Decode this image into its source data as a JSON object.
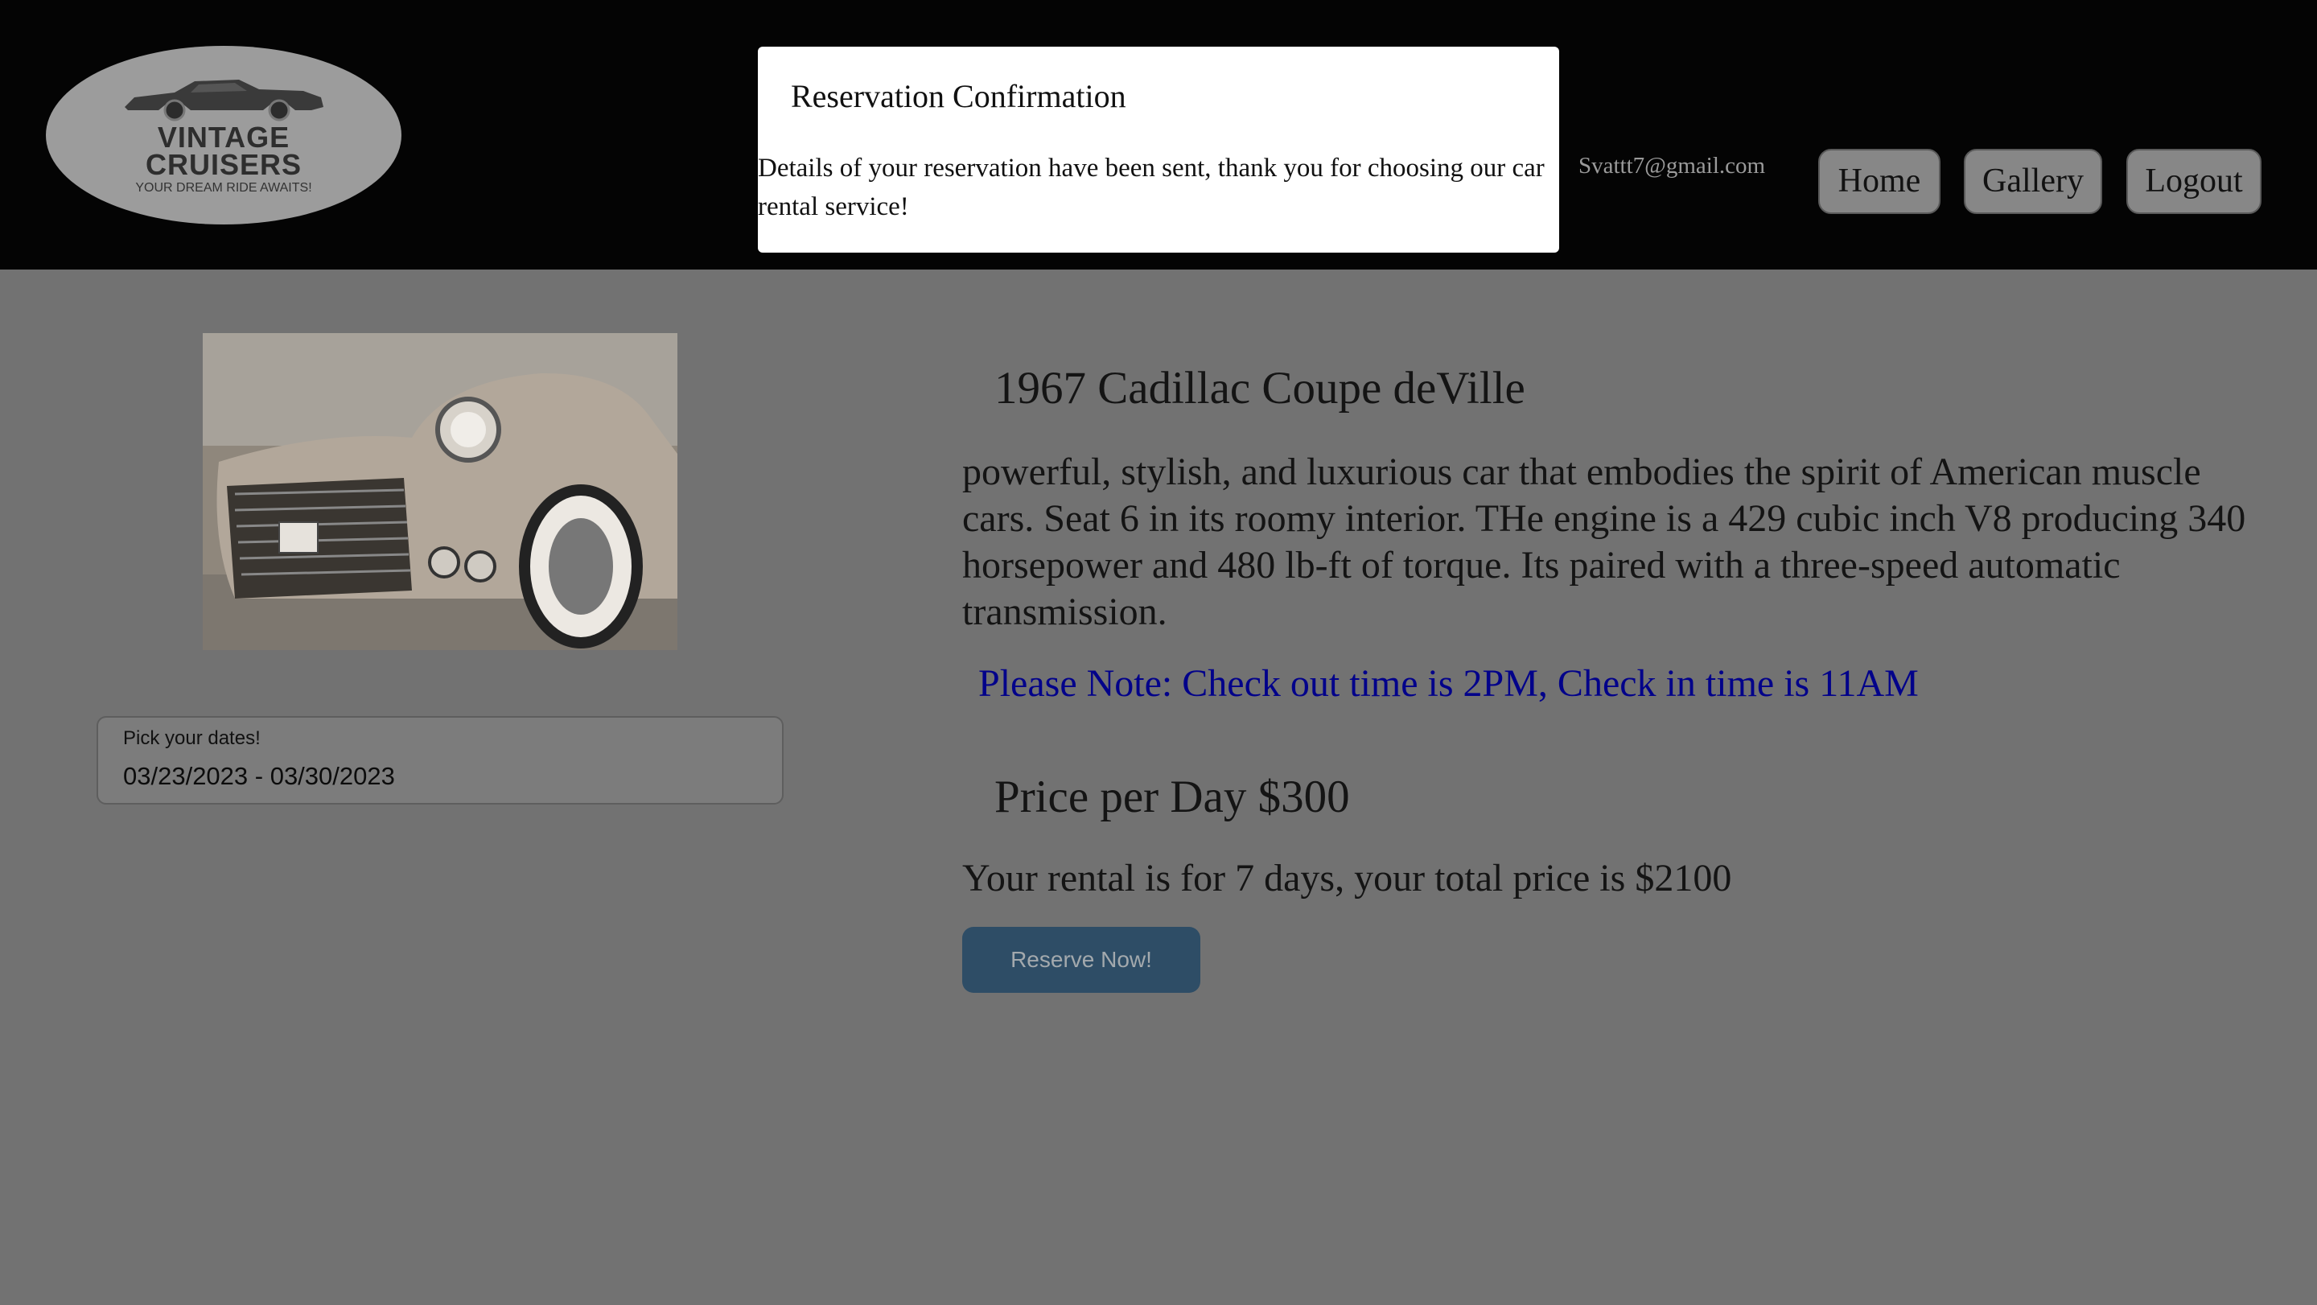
{
  "header": {
    "logo": {
      "line1": "VINTAGE",
      "line2": "CRUISERS",
      "tagline": "YOUR DREAM RIDE AWAITS!"
    },
    "user_email": "Svattt7@gmail.com",
    "nav": {
      "home": "Home",
      "gallery": "Gallery",
      "logout": "Logout"
    }
  },
  "modal": {
    "title": "Reservation Confirmation",
    "body": "Details of your reservation have been sent, thank you for choosing our car rental service!"
  },
  "booking": {
    "date_label": "Pick your dates!",
    "date_value": "03/23/2023 - 03/30/2023"
  },
  "car": {
    "title": "1967 Cadillac Coupe deVille",
    "description": "powerful, stylish, and luxurious car that embodies the spirit of American muscle cars. Seat 6 in its roomy interior. THe engine is a 429 cubic inch V8 producing 340 horsepower and 480 lb-ft of torque. Its paired with a three-speed automatic transmission.",
    "note": "Please Note: Check out time is 2PM, Check in time is 11AM",
    "price": "Price per Day $300",
    "rental_summary": "Your rental is for 7 days, your total price is $2100",
    "reserve_label": "Reserve Now!"
  },
  "colors": {
    "header_bg": "#040404",
    "page_overlay": "#727272",
    "note": "#02028a",
    "reserve_button": "#2e4d66"
  }
}
